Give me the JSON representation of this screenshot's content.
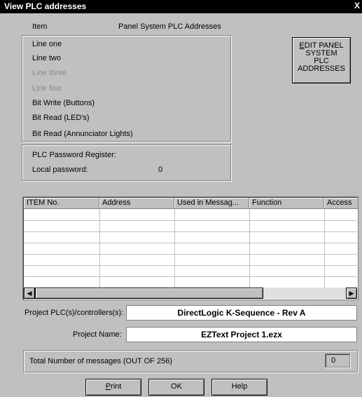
{
  "window": {
    "title": "View PLC addresses",
    "close_label": "X"
  },
  "header": {
    "item_label": "Item",
    "panel_label": "Panel System PLC Addresses"
  },
  "items": [
    {
      "label": "Line one",
      "disabled": false
    },
    {
      "label": "Line two",
      "disabled": false
    },
    {
      "label": "Line three",
      "disabled": true
    },
    {
      "label": "Line four",
      "disabled": true
    },
    {
      "label": "Bit Write (Buttons)",
      "disabled": false
    },
    {
      "label": "Bit Read (LED's)",
      "disabled": false
    },
    {
      "label": "Bit Read (Annunciator Lights)",
      "disabled": false
    }
  ],
  "password": {
    "register_label": "PLC Password Register:",
    "local_label": "Local password:",
    "local_value": "0"
  },
  "edit_button": {
    "line1_u": "E",
    "line1": "DIT PANEL",
    "line2": "SYSTEM",
    "line3": "PLC",
    "line4": "ADDRESSES"
  },
  "table": {
    "columns": [
      "ITEM No.",
      "Address",
      "Used in Messag...",
      "Function",
      "Access"
    ],
    "rows": []
  },
  "project": {
    "plc_label": "Project PLC(s)/controllers(s):",
    "plc_value": "DirectLogic  K-Sequence - Rev A",
    "name_label": "Project Name:",
    "name_value": "EZText Project 1.ezx"
  },
  "messages": {
    "label": "Total Number of messages (OUT OF 256)",
    "count": "0"
  },
  "buttons": {
    "print_u": "P",
    "print_rest": "rint",
    "ok": "OK",
    "help": "Help"
  }
}
